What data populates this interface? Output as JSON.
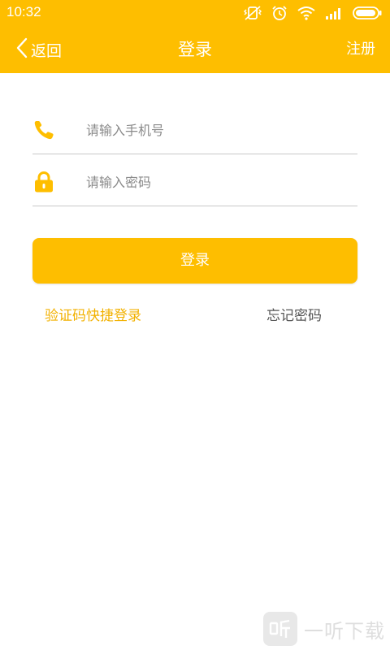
{
  "status_bar": {
    "time": "10:32",
    "icons": [
      "vibrate-icon",
      "alarm-icon",
      "wifi-icon",
      "signal-icon",
      "battery-icon"
    ]
  },
  "nav": {
    "back_label": "返回",
    "title": "登录",
    "register_label": "注册"
  },
  "form": {
    "phone_placeholder": "请输入手机号",
    "phone_value": "",
    "password_placeholder": "请输入密码",
    "password_value": ""
  },
  "actions": {
    "login_label": "登录",
    "sms_login_label": "验证码快捷登录",
    "forgot_password_label": "忘记密码"
  },
  "watermark": {
    "text": "一听下载"
  },
  "colors": {
    "accent": "#FEBE00",
    "link_accent": "#F2B100",
    "divider": "#C8C8C8",
    "secondary_text": "#555555"
  }
}
